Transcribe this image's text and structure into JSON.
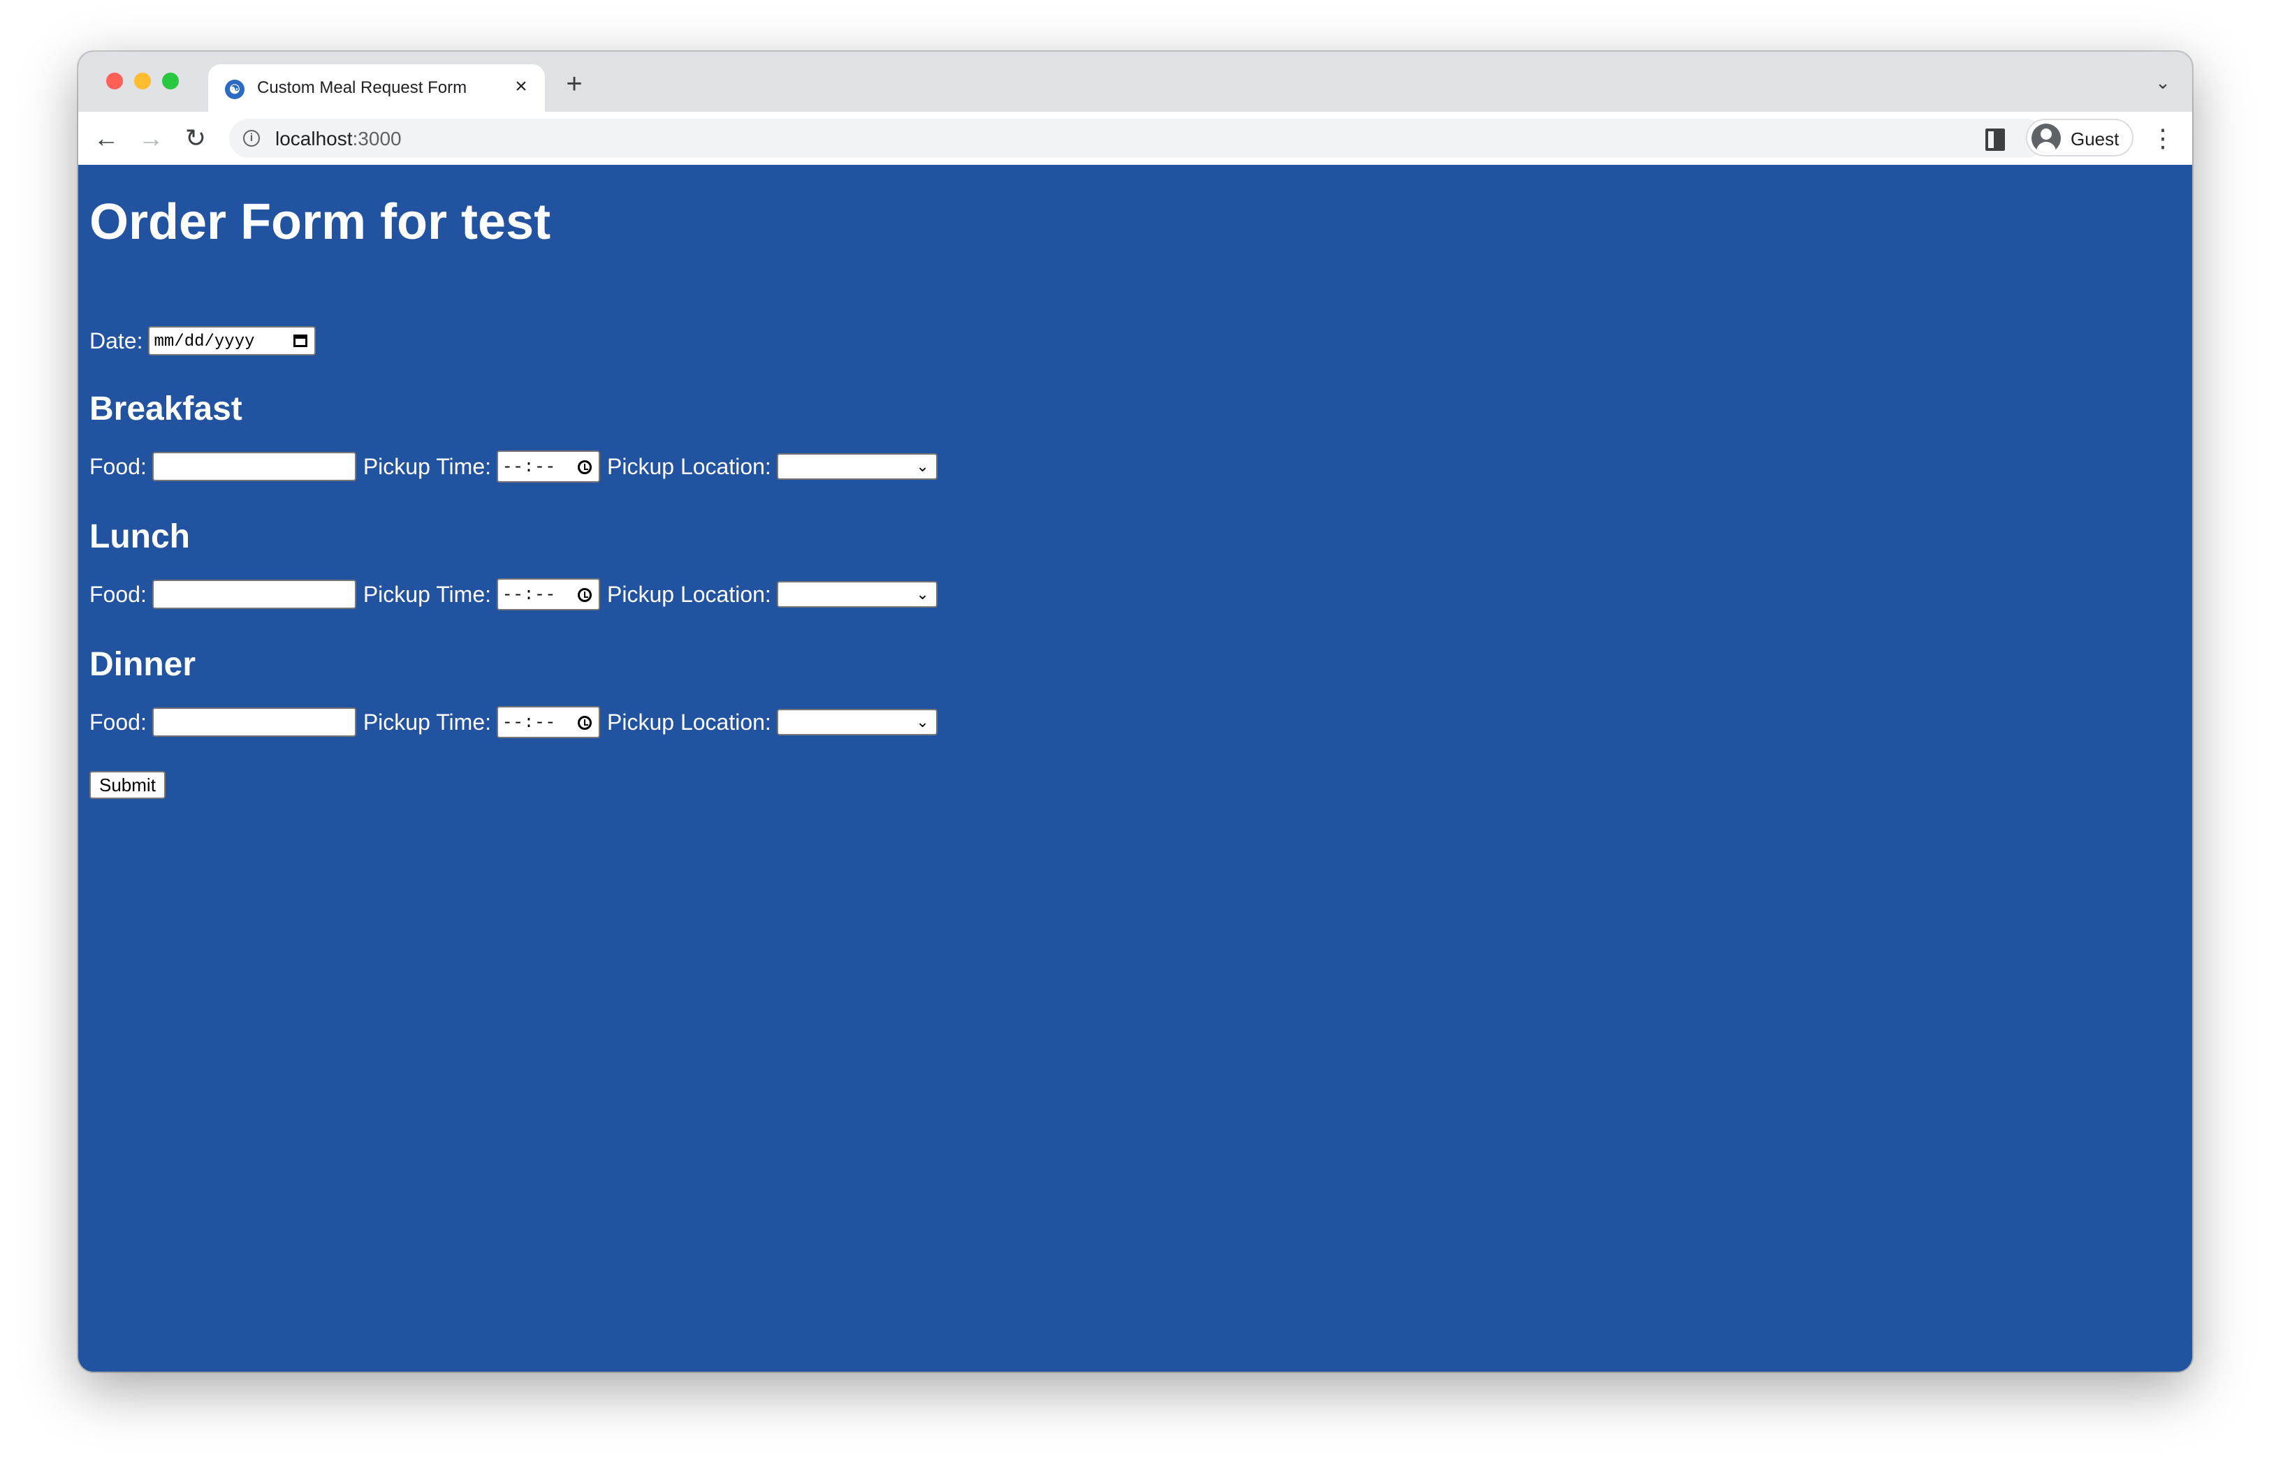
{
  "browser": {
    "tab_title": "Custom Meal Request Form",
    "tab_favicon": "☯",
    "new_tab": "+",
    "tab_close": "×",
    "tab_search": "⌄",
    "url_host": "localhost",
    "url_port": ":3000",
    "profile_name": "Guest",
    "back_icon": "←",
    "forward_icon": "→",
    "reload_icon": "↻",
    "menu_icon": "⋮",
    "info_icon": "i"
  },
  "page": {
    "title": "Order Form for test",
    "date_label": "Date:",
    "date_placeholder": "mm/dd/yyyy",
    "food_label": "Food:",
    "time_label": "Pickup Time:",
    "time_placeholder": "--:--",
    "location_label": "Pickup Location:",
    "select_chevron": "⌄",
    "meals": [
      {
        "name": "Breakfast",
        "food": "",
        "time": "",
        "location": ""
      },
      {
        "name": "Lunch",
        "food": "",
        "time": "",
        "location": ""
      },
      {
        "name": "Dinner",
        "food": "",
        "time": "",
        "location": ""
      }
    ],
    "submit_label": "Submit"
  },
  "colors": {
    "page_background": "#2253a0",
    "text": "#ffffff"
  }
}
